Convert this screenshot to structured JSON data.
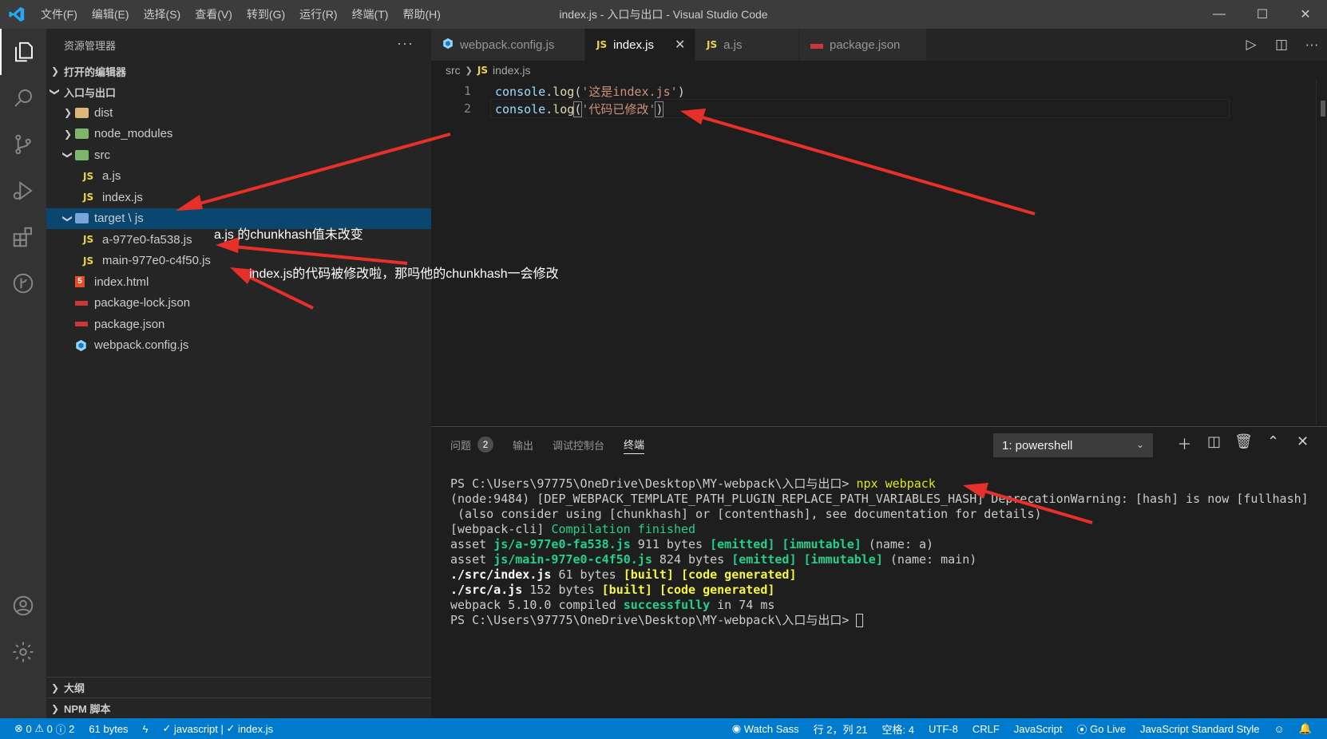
{
  "titlebar": {
    "menu": [
      "文件(F)",
      "编辑(E)",
      "选择(S)",
      "查看(V)",
      "转到(G)",
      "运行(R)",
      "终端(T)",
      "帮助(H)"
    ],
    "title": "index.js - 入口与出口 - Visual Studio Code"
  },
  "sidebar": {
    "title": "资源管理器",
    "open_editors": "打开的编辑器",
    "project": "入口与出口",
    "tree": {
      "dist": "dist",
      "node_modules": "node_modules",
      "src": "src",
      "a_js": "a.js",
      "index_js": "index.js",
      "target": "target \\ js",
      "a_hash_js": "a-977e0-fa538.js",
      "main_hash_js": "main-977e0-c4f50.js",
      "index_html": "index.html",
      "package_lock": "package-lock.json",
      "package_json": "package.json",
      "webpack_config": "webpack.config.js"
    },
    "outline": "大纲",
    "npm_scripts": "NPM 脚本"
  },
  "tabs": [
    {
      "label": "webpack.config.js",
      "icon": "webpack-icon"
    },
    {
      "label": "index.js",
      "icon": "js-icon",
      "active": true
    },
    {
      "label": "a.js",
      "icon": "js-icon"
    },
    {
      "label": "package.json",
      "icon": "json-icon"
    }
  ],
  "breadcrumb": {
    "folder": "src",
    "file": "index.js"
  },
  "editor": {
    "lines": [
      {
        "num": "1",
        "obj": "console",
        "dot": ".",
        "fn": "log",
        "open": "(",
        "str": "'这是index.js'",
        "close": ")"
      },
      {
        "num": "2",
        "obj": "console",
        "dot": ".",
        "fn": "log",
        "open": "(",
        "str": "'代码已修改'",
        "close": ")"
      }
    ]
  },
  "panel": {
    "tabs": {
      "problems": "问题",
      "problems_count": "2",
      "output": "输出",
      "debug": "调试控制台",
      "terminal": "终端"
    },
    "shell": "1: powershell",
    "terminal_lines": {
      "l1_prompt": "PS C:\\Users\\97775\\OneDrive\\Desktop\\MY-webpack\\入口与出口> ",
      "l1_cmd": "npx webpack",
      "l2": "(node:9484) [DEP_WEBPACK_TEMPLATE_PATH_PLUGIN_REPLACE_PATH_VARIABLES_HASH] DeprecationWarning: [hash] is now [fullhash]",
      "l3": " (also consider using [chunkhash] or [contenthash], see documentation for details)",
      "l4a": "[webpack-cli] ",
      "l4b": "Compilation finished",
      "l5a": "asset ",
      "l5b": "js/a-977e0-fa538.js",
      "l5c": " 911 bytes ",
      "l5d": "[emitted] [immutable]",
      "l5e": " (name: a)",
      "l6a": "asset ",
      "l6b": "js/main-977e0-c4f50.js",
      "l6c": " 824 bytes ",
      "l6d": "[emitted] [immutable]",
      "l6e": " (name: main)",
      "l7a": "./src/index.js",
      "l7b": " 61 bytes ",
      "l7c": "[built] [code generated]",
      "l8a": "./src/a.js",
      "l8b": " 152 bytes ",
      "l8c": "[built] [code generated]",
      "l9a": "webpack 5.10.0 compiled ",
      "l9b": "successfully",
      "l9c": " in 74 ms",
      "l10": "PS C:\\Users\\97775\\OneDrive\\Desktop\\MY-webpack\\入口与出口> "
    }
  },
  "statusbar": {
    "errors": "0",
    "warnings": "0",
    "infos": "2",
    "size": "61 bytes",
    "lint": "javascript",
    "file": "index.js",
    "watch_sass": "Watch Sass",
    "position": "行 2，列 21",
    "spaces": "空格: 4",
    "encoding": "UTF-8",
    "eol": "CRLF",
    "language": "JavaScript",
    "go_live": "Go Live",
    "style": "JavaScript Standard Style"
  },
  "annotations": {
    "a_hash_note": "a.js 的chunkhash值未改变",
    "main_hash_note": "index.js的代码被修改啦，那吗他的chunkhash一会修改"
  },
  "colors": {
    "accent": "#007acc",
    "arrow": "#e8302a",
    "selection": "#094771"
  }
}
